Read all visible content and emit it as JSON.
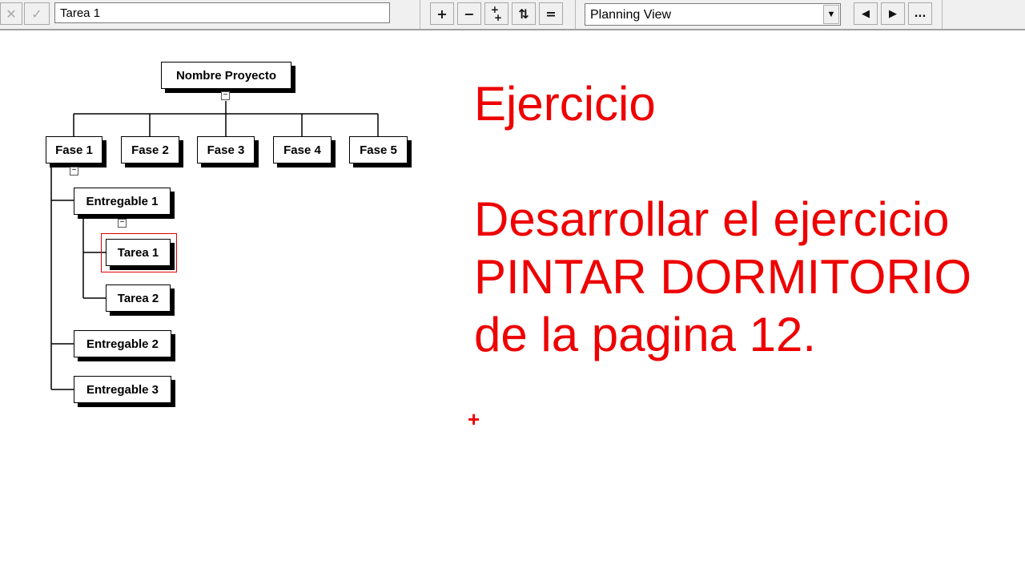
{
  "toolbar": {
    "cancel_icon": "close-icon",
    "confirm_icon": "check-icon",
    "task_input_value": "Tarea 1",
    "outline_buttons": [
      {
        "name": "add-button",
        "icon": "plus-icon",
        "glyph": "+"
      },
      {
        "name": "remove-button",
        "icon": "minus-icon",
        "glyph": "−"
      },
      {
        "name": "insert-child-button",
        "icon": "plus-plus-icon",
        "glyph": "+"
      },
      {
        "name": "move-up-down-button",
        "icon": "arrows-updown-icon",
        "glyph": "⇅"
      },
      {
        "name": "collapse-all-button",
        "icon": "minus-lines-icon",
        "glyph": "="
      }
    ],
    "view_selected": "Planning View",
    "view_dropdown_icon": "chevron-down-icon",
    "nav_buttons": [
      {
        "name": "prev-button",
        "icon": "triangle-left-icon",
        "glyph": "◀"
      },
      {
        "name": "next-button",
        "icon": "triangle-right-icon",
        "glyph": "▶"
      },
      {
        "name": "more-button",
        "icon": "ellipsis-icon",
        "glyph": "..."
      }
    ]
  },
  "wbs": {
    "root": "Nombre Proyecto",
    "phases": [
      "Fase 1",
      "Fase 2",
      "Fase 3",
      "Fase 4",
      "Fase 5"
    ],
    "deliverables": [
      "Entregable 1",
      "Entregable 2",
      "Entregable 3"
    ],
    "tasks": [
      "Tarea 1",
      "Tarea 2"
    ],
    "selected_task": "Tarea 1",
    "collapse_glyph": "−"
  },
  "note": {
    "title": "Ejercicio",
    "lines": [
      "Desarrollar el ejercicio",
      "PINTAR DORMITORIO",
      "de la pagina 12."
    ],
    "color": "#ee0000"
  },
  "cursor_glyph": "+"
}
